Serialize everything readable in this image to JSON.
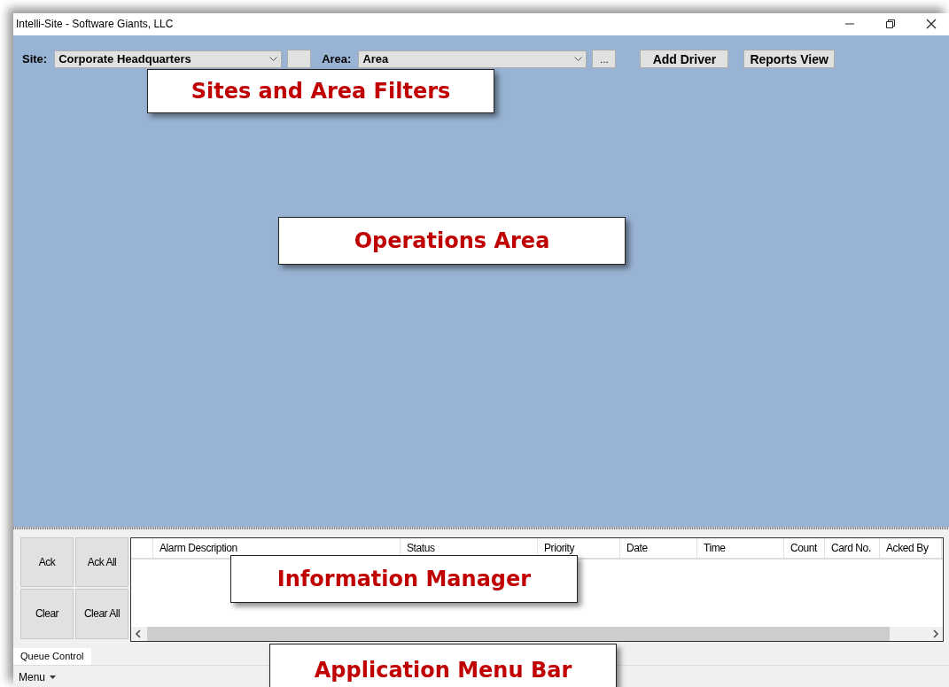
{
  "window": {
    "title": "Intelli-Site - Software Giants, LLC"
  },
  "filters": {
    "site_label": "Site:",
    "site_value": "Corporate Headquarters",
    "area_label": "Area:",
    "area_value": "Area",
    "area_button": "...",
    "buttons": [
      "Add Driver",
      "Reports View"
    ]
  },
  "queue_buttons": [
    "Ack",
    "Ack All",
    "Clear",
    "Clear All"
  ],
  "alarm_table": {
    "columns": [
      "",
      "Alarm Description",
      "Status",
      "Priority",
      "Date",
      "Time",
      "Count",
      "Card No.",
      "Acked By"
    ]
  },
  "tabs": [
    {
      "label": "Queue Control",
      "selected": true
    }
  ],
  "menu_bar": {
    "label": "Menu"
  },
  "callouts": [
    {
      "text": "Sites and Area Filters",
      "kind": "filters"
    },
    {
      "text": "Operations Area",
      "kind": "operations"
    },
    {
      "text": "Information Manager",
      "kind": "info"
    },
    {
      "text": "Application Menu Bar",
      "kind": "menu"
    }
  ]
}
